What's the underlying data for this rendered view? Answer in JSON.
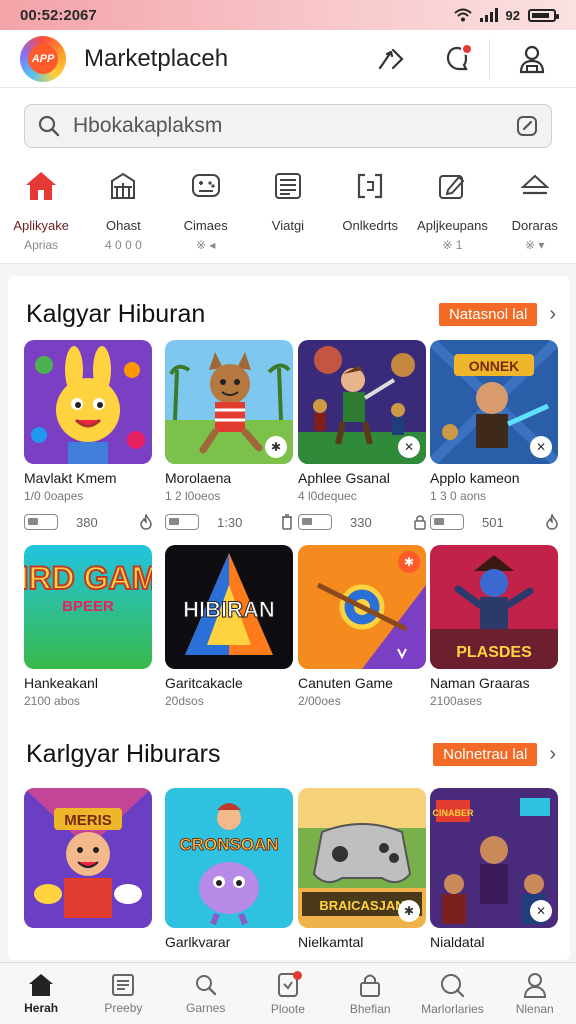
{
  "status_bar": {
    "time": "00:52:2067",
    "network": "92",
    "icons": [
      "wifi-icon",
      "signal-icon",
      "battery-icon"
    ]
  },
  "app_bar": {
    "title": "Marketplaceh",
    "logo_text": "APP",
    "actions": [
      "share-icon",
      "notification-icon",
      "profile-icon"
    ]
  },
  "search": {
    "placeholder": "Hbokakaplaksm"
  },
  "categories": [
    {
      "label": "Aplikyake",
      "sub": "Aprias",
      "icon": "home-icon",
      "active": true
    },
    {
      "label": "Ohast",
      "sub": "4 0 0 0",
      "icon": "store-icon"
    },
    {
      "label": "Cimaes",
      "sub": "※ ◂",
      "icon": "game-icon"
    },
    {
      "label": "Viatgi",
      "sub": "",
      "icon": "list-icon"
    },
    {
      "label": "Onlkedrts",
      "sub": "",
      "icon": "bracket-icon"
    },
    {
      "label": "Apljkeupans",
      "sub": "※ 1",
      "icon": "edit-icon"
    },
    {
      "label": "Doraras",
      "sub": "※ ▾",
      "icon": "eject-icon"
    }
  ],
  "section1": {
    "title": "Kalgyar Hiburan",
    "more_label": "Natasnol lal",
    "row1": [
      {
        "name": "Mavlakt Kmem",
        "downloads": "1/0 0oapes",
        "count": "380"
      },
      {
        "name": "Morolaena",
        "downloads": "1 2 l0oeos",
        "count": "1:30"
      },
      {
        "name": "Aphlee Gsanal",
        "downloads": "4 l0dequec",
        "count": "330"
      },
      {
        "name": "Applo kameon",
        "downloads": "1 3 0 aons",
        "count": "501"
      }
    ],
    "row2": [
      {
        "name": "Hankeakanl",
        "downloads": "2100 abos"
      },
      {
        "name": "Garitcakacle",
        "downloads": "20dsos"
      },
      {
        "name": "Canuten Game",
        "downloads": "2/00oes"
      },
      {
        "name": "Naman Graaras",
        "downloads": "2100ases"
      }
    ]
  },
  "section2": {
    "title": "Karlgyar Hiburars",
    "more_label": "Nolnetrau lal",
    "row1": [
      {
        "name": "",
        "downloads": ""
      },
      {
        "name": "Garlkvarar",
        "downloads": ""
      },
      {
        "name": "Nielkamtal",
        "downloads": ""
      },
      {
        "name": "Nialdatal",
        "downloads": ""
      }
    ]
  },
  "art_text": {
    "bird_game": "BIRD GAME",
    "bird_sub": "BPEER",
    "hibiran": "HIBIRAN",
    "plasdes": "PLASDES",
    "meris": "MERIS",
    "cronsoan": "CRONSOAN",
    "braicasjan": "BRAICASJAN",
    "cinaber": "CINABER"
  },
  "bottom_nav": [
    {
      "label": "Herah",
      "icon": "home-icon",
      "active": true
    },
    {
      "label": "Preeby",
      "icon": "doc-icon"
    },
    {
      "label": "Garnes",
      "icon": "search-icon"
    },
    {
      "label": "Ploote",
      "icon": "phone-icon"
    },
    {
      "label": "Bhefian",
      "icon": "lock-icon"
    },
    {
      "label": "Marlorlaries",
      "icon": "chat-icon"
    },
    {
      "label": "Nlenan",
      "icon": "user-icon"
    }
  ],
  "colors": {
    "accent": "#f26a25",
    "home_red": "#e53935",
    "status_bar": "#f3a3a8"
  }
}
